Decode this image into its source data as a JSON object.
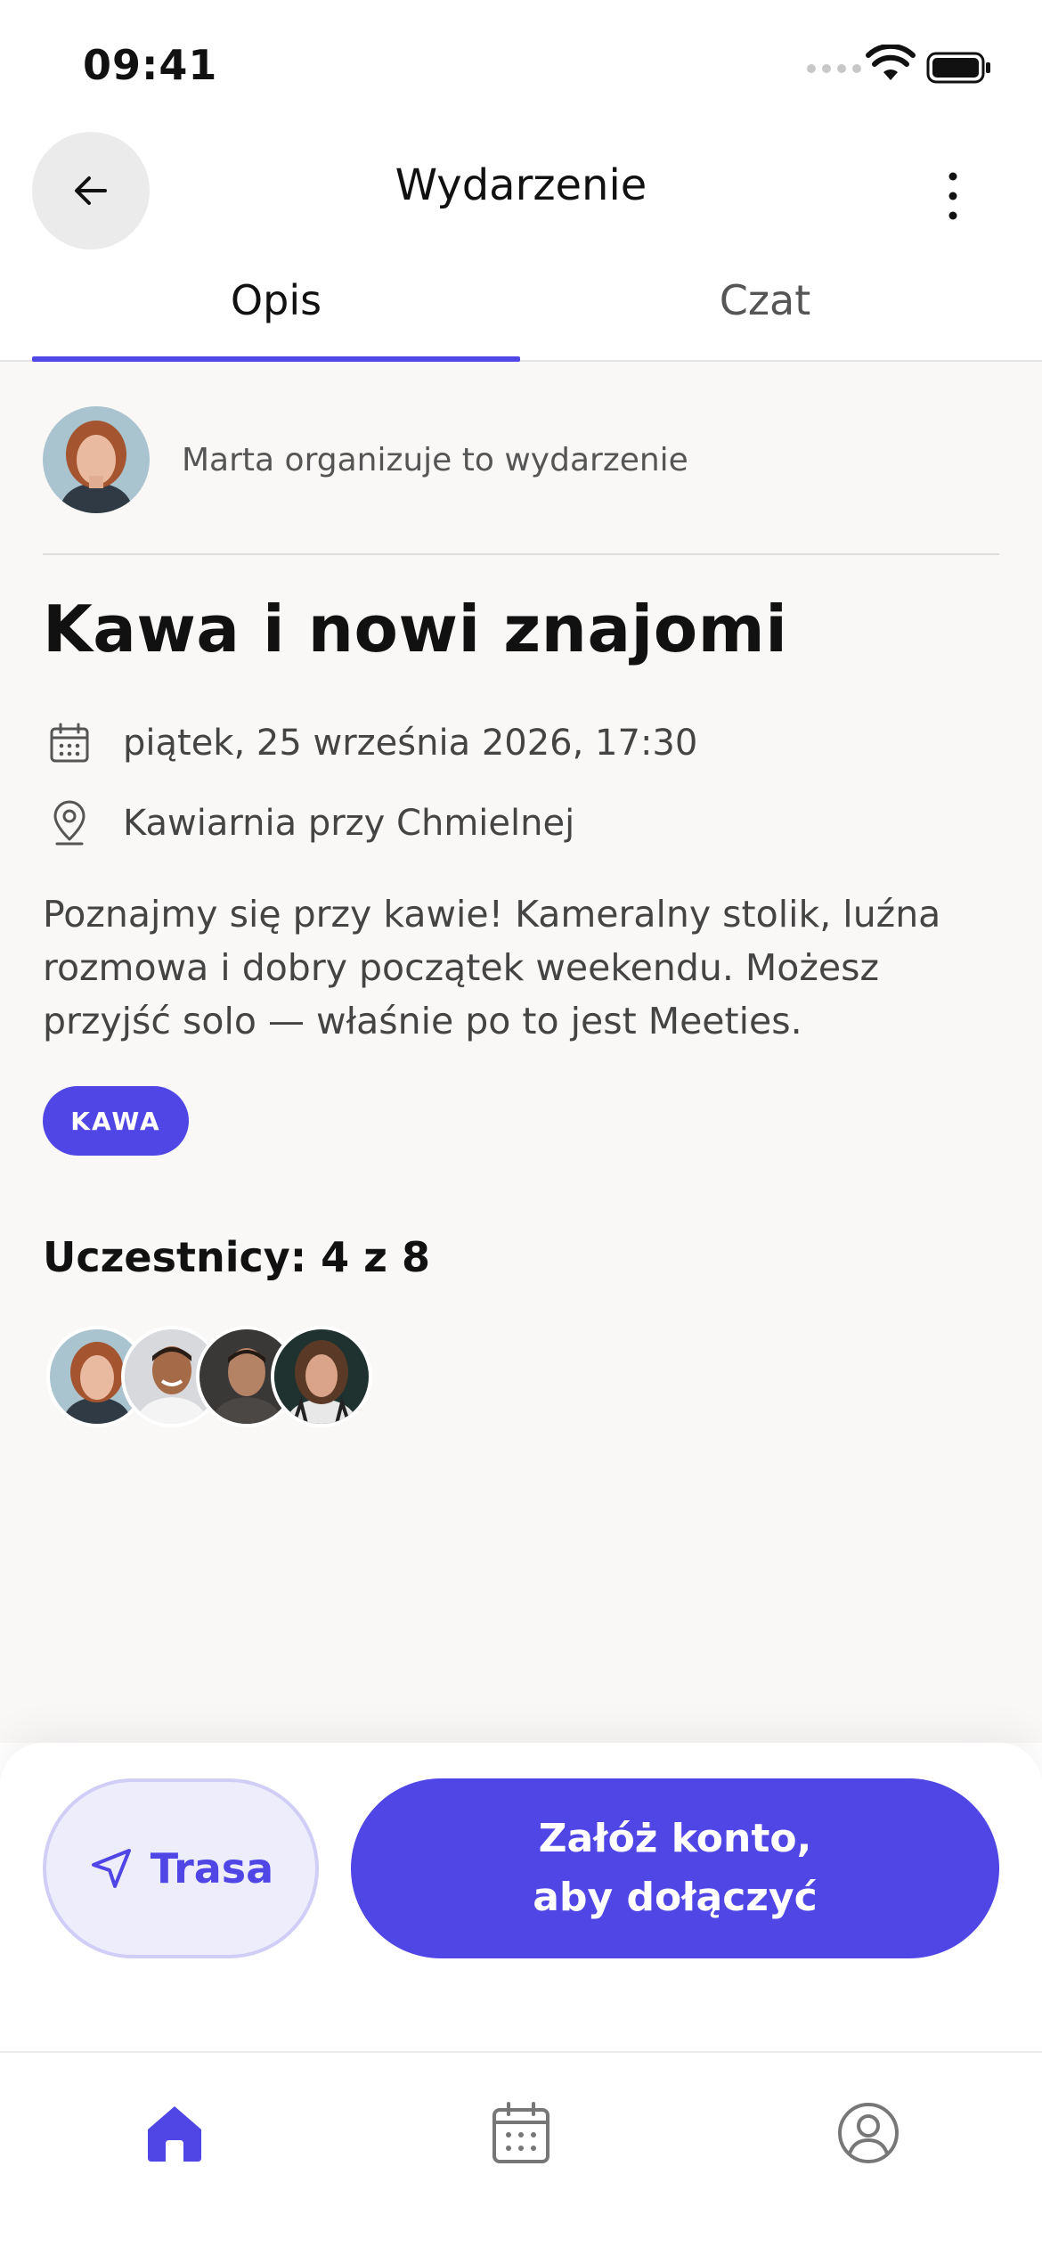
{
  "status_bar": {
    "time": "09:41"
  },
  "header": {
    "title": "Wydarzenie"
  },
  "tabs": [
    {
      "label": "Opis",
      "active": true
    },
    {
      "label": "Czat",
      "active": false
    }
  ],
  "organizer": {
    "text": "Marta organizuje to wydarzenie"
  },
  "event": {
    "title": "Kawa i nowi znajomi",
    "datetime": "piątek, 25 września 2026, 17:30",
    "place": "Kawiarnia przy Chmielnej",
    "description": "Poznajmy się przy kawie! Kameralny stolik, luźna rozmowa i dobry początek weekendu. Możesz przyjść solo — właśnie po to jest Meeties.",
    "tag": "KAWA"
  },
  "participants": {
    "title": "Uczestnicy: 4 z 8",
    "count": 4,
    "max": 8
  },
  "actions": {
    "route_label": "Trasa",
    "join_line1": "Załóż konto,",
    "join_line2": "aby dołączyć"
  },
  "tab_bar": {
    "items": [
      {
        "icon": "home-icon",
        "active": true
      },
      {
        "icon": "calendar-icon",
        "active": false
      },
      {
        "icon": "profile-icon",
        "active": false
      }
    ]
  },
  "colors": {
    "accent": "#4f46e5",
    "accent_light": "#ededfc",
    "background": "#f9f8f7",
    "text": "#111111",
    "muted": "#444444"
  }
}
